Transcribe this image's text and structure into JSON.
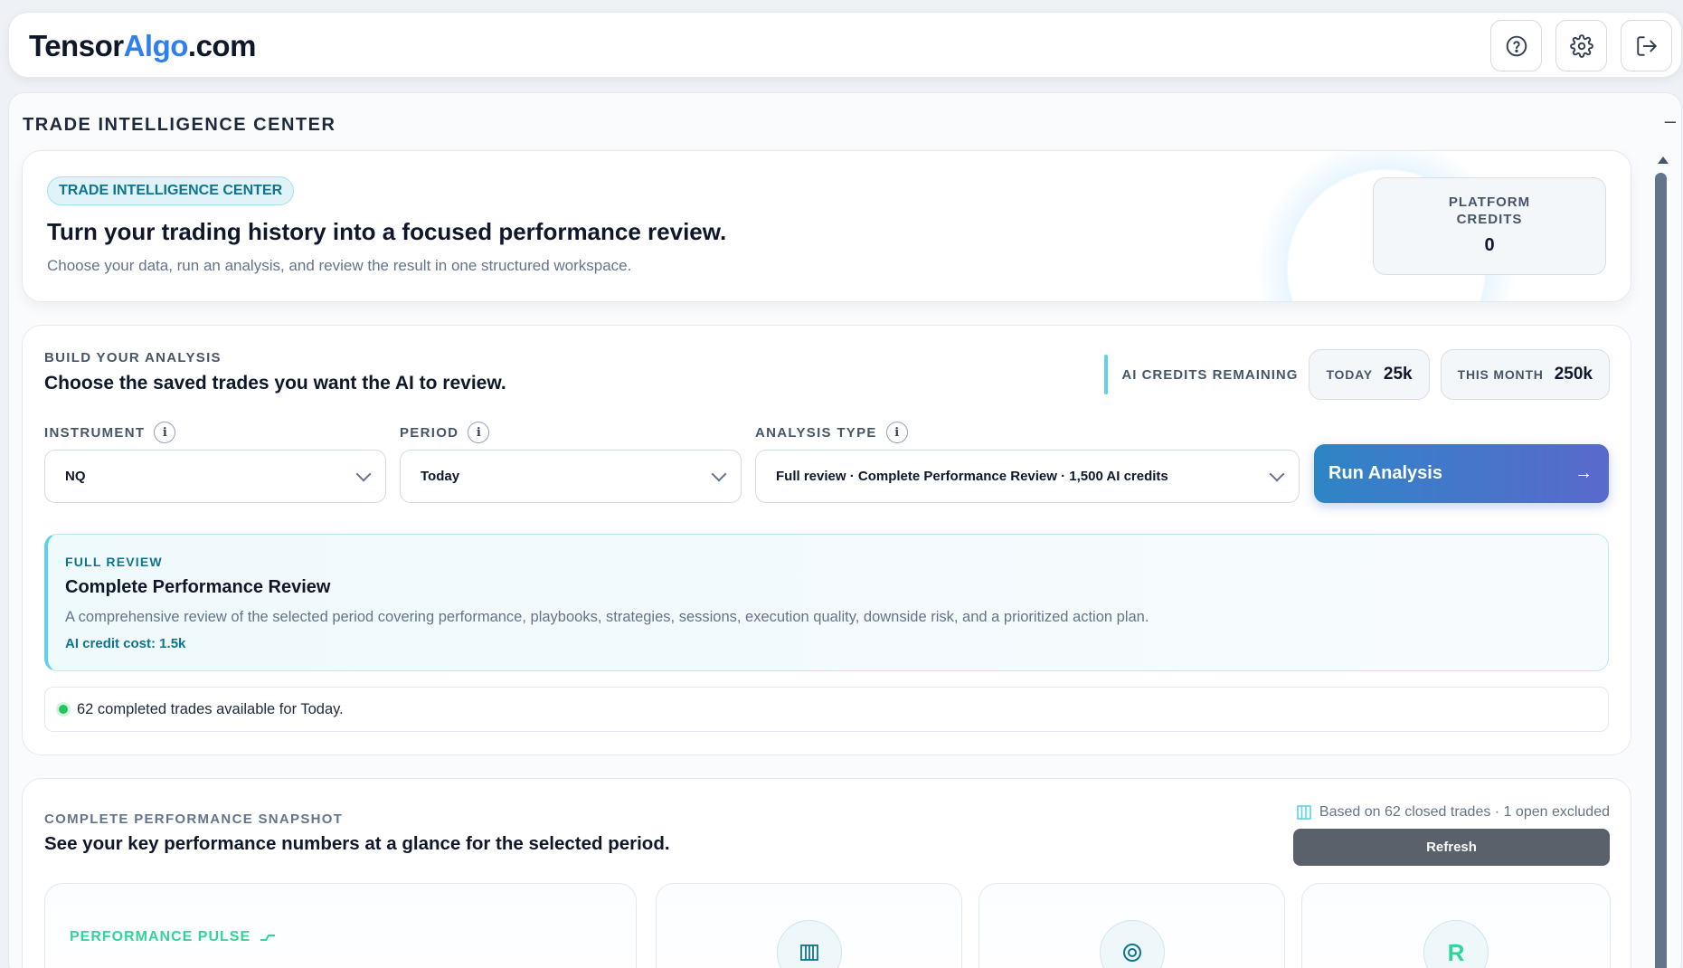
{
  "header": {
    "logo_part1": "Tensor",
    "logo_part2": "Algo",
    "logo_part3": ".com",
    "icons": [
      "help-icon",
      "settings-icon",
      "logout-icon"
    ]
  },
  "panel": {
    "title": "TRADE INTELLIGENCE CENTER",
    "collapse_label": "–"
  },
  "hero": {
    "badge": "TRADE INTELLIGENCE CENTER",
    "title": "Turn your trading history into a focused performance review.",
    "subtitle": "Choose your data, run an analysis, and review the result in one structured workspace.",
    "credits_label": "PLATFORM CREDITS",
    "credits_value": "0"
  },
  "build": {
    "eyebrow": "BUILD YOUR ANALYSIS",
    "heading": "Choose the saved trades you want the AI to review.",
    "ai_credits_label": "AI CREDITS REMAINING",
    "today_label": "TODAY",
    "today_value": "25k",
    "month_label": "THIS MONTH",
    "month_value": "250k",
    "instrument_label": "INSTRUMENT",
    "instrument_value": "NQ",
    "period_label": "PERIOD",
    "period_value": "Today",
    "analysis_label": "ANALYSIS TYPE",
    "analysis_value": "Full review · Complete Performance Review · 1,500 AI credits",
    "run_label": "Run Analysis",
    "run_arrow": "→",
    "info_glyph": "i",
    "review": {
      "eyebrow": "FULL REVIEW",
      "title": "Complete Performance Review",
      "description": "A comprehensive review of the selected period covering performance, playbooks, strategies, sessions, execution quality, downside risk, and a prioritized action plan.",
      "cost": "AI credit cost: 1.5k"
    },
    "availability": "62 completed trades available for Today."
  },
  "snapshot": {
    "eyebrow": "COMPLETE PERFORMANCE SNAPSHOT",
    "heading": "See your key performance numbers at a glance for the selected period.",
    "meta": "Based on 62 closed trades · 1 open excluded",
    "refresh_label": "Refresh",
    "pulse_label": "PERFORMANCE PULSE",
    "card_icons": [
      "bars-icon",
      "target-icon",
      "r-multiple-icon"
    ],
    "r_glyph": "R"
  },
  "colors": {
    "brand_blue": "#2f80ed",
    "accent_cyan": "#5fd0ec",
    "teal_text": "#0e7490",
    "green": "#34d399",
    "button_gradient_start": "#2e85c6",
    "button_gradient_end": "#5a69cc"
  }
}
